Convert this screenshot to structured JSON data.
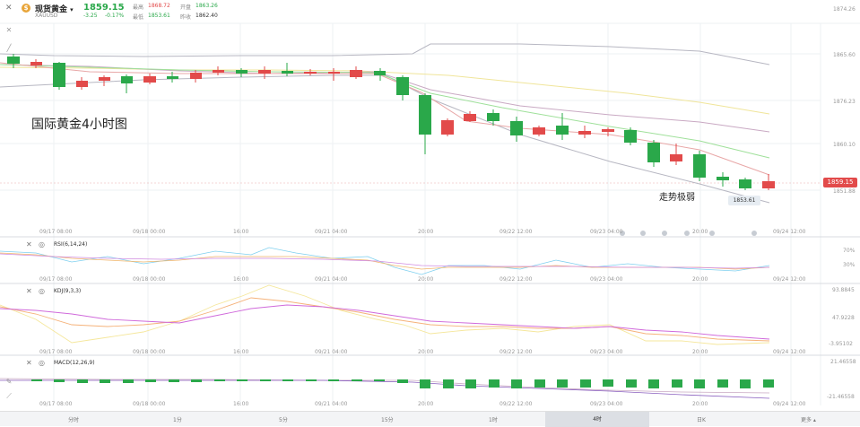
{
  "header": {
    "symbol_name": "现货黄金",
    "symbol_code": "XAUUSD",
    "price": "1859.15",
    "change": "-3.25",
    "change_pct": "-0.17%",
    "high_label": "最高",
    "high": "1868.72",
    "open_label": "开盘",
    "open": "1863.26",
    "low_label": "最低",
    "low": "1853.61",
    "prev_close_label": "昨收",
    "prev_close": "1862.40"
  },
  "main_chart": {
    "annotation_title": "国际黄金4小时图",
    "annotation_trend": "走势极弱",
    "y_ticks": [
      "1874.26",
      "1865.60",
      "1876.23",
      "1860.10",
      "1851.88"
    ],
    "current_price_tag": "1859.15",
    "low_tag": "1853.61",
    "x_ticks": [
      "09/17 08:00",
      "09/18 00:00",
      "16:00",
      "09/21 04:00",
      "20:00",
      "09/22 12:00",
      "09/23 04:00",
      "20:00",
      "09/24 12:00"
    ]
  },
  "rsi": {
    "title": "RSI(6,14,24)",
    "y_ticks": [
      "70%",
      "30%"
    ],
    "x_ticks": [
      "09/17 08:00",
      "09/18 00:00",
      "16:00",
      "09/21 04:00",
      "20:00",
      "09/22 12:00",
      "09/23 04:00",
      "20:00",
      "09/24 12:00"
    ]
  },
  "kdj": {
    "title": "KDJ(9,3,3)",
    "y_ticks": [
      "93.8845",
      "47.9228",
      "-3.95102"
    ],
    "x_ticks": [
      "09/17 08:00",
      "09/18 00:00",
      "16:00",
      "09/21 04:00",
      "20:00",
      "09/22 12:00",
      "09/23 04:00",
      "20:00",
      "09/24 12:00"
    ]
  },
  "macd": {
    "title": "MACD(12,26,9)",
    "y_ticks": [
      "21.46558",
      "-21.46558"
    ],
    "x_ticks": [
      "09/17 08:00",
      "09/18 00:00",
      "16:00",
      "09/21 04:00",
      "20:00",
      "09/22 12:00",
      "09/23 04:00",
      "20:00",
      "09/24 12:00"
    ]
  },
  "timeframes": [
    "分时",
    "1分",
    "5分",
    "15分",
    "1时",
    "4时",
    "日K"
  ],
  "more_label": "更多",
  "colors": {
    "up": "#e24a4a",
    "down": "#2aa84a",
    "accent": "#e8a53a"
  }
}
